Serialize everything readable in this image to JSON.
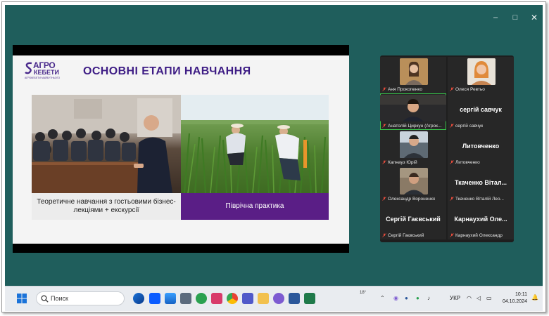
{
  "window": {
    "minimize_glyph": "–",
    "maximize_glyph": "□",
    "close_glyph": "✕",
    "bg_color": "#1f5e5c"
  },
  "slide": {
    "logo": {
      "line1": "АГРО",
      "line2": "КЕБЕТИ",
      "line3": "АГРОКЕБЕТИ МАЙБУТНЬОГО"
    },
    "title": "ОСНОВНІ ЕТАПИ НАВЧАННЯ",
    "left_caption": "Теоретичне навчання з гостьовими бізнес-лекціями + екскурсії",
    "right_caption": "Піврічна практика",
    "accent_color": "#5a1e86"
  },
  "participants": [
    {
      "name": "Аня Прокопенко",
      "display": "",
      "video": true
    },
    {
      "name": "Олеся Ревтьо",
      "display": "",
      "video": true
    },
    {
      "name": "Анатолій Циркун (Агрок...",
      "display": "",
      "video": true,
      "active_speaker": true
    },
    {
      "name": "сергій савчук",
      "display": "сергій савчук",
      "video": false
    },
    {
      "name": "Калнауз Юрій",
      "display": "",
      "video": true
    },
    {
      "name": "Литовченко",
      "display": "Литовченко",
      "video": false
    },
    {
      "name": "Олександр Вороненко",
      "display": "",
      "video": true
    },
    {
      "name": "Ткаченко Віталій Лео...",
      "display": "Ткаченко Вітал...",
      "video": false
    },
    {
      "name": "Сергій Гаєвський",
      "display": "Сергій Гаєвський",
      "video": false
    },
    {
      "name": "Карнаухий Олександр",
      "display": "Карнаухий Оле...",
      "video": false
    }
  ],
  "taskbar": {
    "search_placeholder": "Поиск",
    "apps": [
      "edge-icon",
      "zoom-icon",
      "store-icon",
      "calc-icon",
      "paint-icon",
      "whatsapp-icon",
      "snip-icon",
      "chrome-icon",
      "teams-icon",
      "explorer-icon",
      "viber-icon",
      "word-icon"
    ],
    "weather_temp": "18°",
    "language": "УКР",
    "time": "10:11",
    "date": "04.10.2024"
  }
}
